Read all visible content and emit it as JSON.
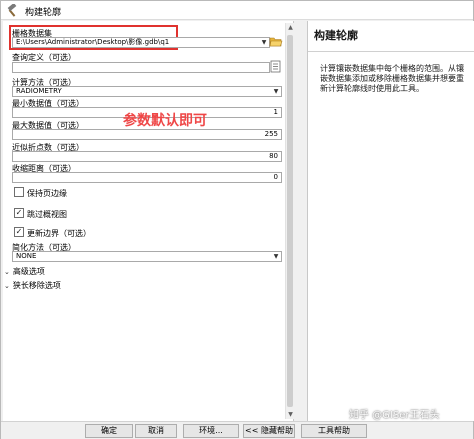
{
  "window": {
    "title": "构建轮廓"
  },
  "form": {
    "raster_dataset": {
      "label": "栅格数据集",
      "value": "E:\\Users\\Administrator\\Desktop\\影像.gdb\\q1"
    },
    "query_definition": {
      "label": "查询定义（可选）",
      "value": ""
    },
    "compute_method": {
      "label": "计算方法（可选）",
      "value": "RADIOMETRY"
    },
    "min_value": {
      "label": "最小数据值（可选）",
      "value": "1"
    },
    "max_value": {
      "label": "最大数据值（可选）",
      "value": "255"
    },
    "approx_vertices": {
      "label": "近似折点数（可选）",
      "value": "80"
    },
    "shrink_distance": {
      "label": "收缩距离（可选）",
      "value": "0"
    },
    "maintain_edge": {
      "label": "保持页边缘",
      "checked": false
    },
    "skip_overviews": {
      "label": "跳过概视图",
      "checked": true
    },
    "update_boundary": {
      "label": "更新边界（可选）",
      "checked": true
    },
    "simplify_method": {
      "label": "简化方法（可选）",
      "value": "NONE"
    },
    "advanced_options": {
      "label": "高级选项"
    },
    "long_strip_options": {
      "label": "狭长移除选项"
    }
  },
  "annotation": {
    "text": "参数默认即可",
    "color": "#ef4747"
  },
  "help_panel": {
    "title": "构建轮廓",
    "description": "计算镶嵌数据集中每个栅格的范围。从镶嵌数据集添加或移除栅格数据集并想要重新计算轮廓线时使用此工具。"
  },
  "buttons": {
    "ok": "确定",
    "cancel": "取消",
    "environments": "环境...",
    "hide_help": "<< 隐藏帮助",
    "tool_help": "工具帮助"
  },
  "watermark": "知乎 @GISer王石头"
}
